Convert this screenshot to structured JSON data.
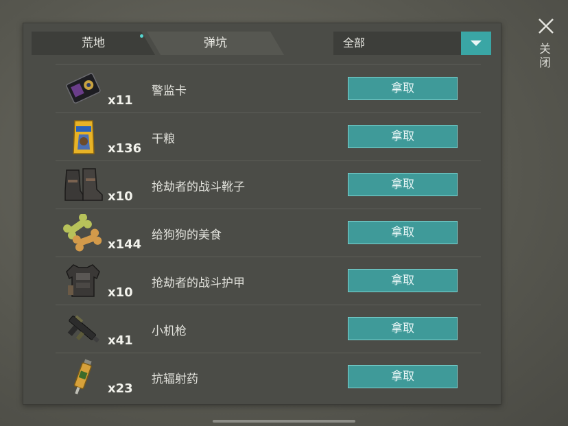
{
  "tabs": [
    {
      "label": "荒地",
      "active": true,
      "has_notification": true
    },
    {
      "label": "弹坑",
      "active": false
    }
  ],
  "filter": {
    "selected": "全部"
  },
  "close": {
    "label": "关闭"
  },
  "take_label": "拿取",
  "items": [
    {
      "count": "x11",
      "name": "警监卡",
      "icon": "police-card-icon"
    },
    {
      "count": "x136",
      "name": "干粮",
      "icon": "dry-food-bag-icon"
    },
    {
      "count": "x10",
      "name": "抢劫者的战斗靴子",
      "icon": "combat-boots-icon"
    },
    {
      "count": "x144",
      "name": "给狗狗的美食",
      "icon": "dog-treat-bone-icon"
    },
    {
      "count": "x10",
      "name": "抢劫者的战斗护甲",
      "icon": "combat-armor-icon"
    },
    {
      "count": "x41",
      "name": "小机枪",
      "icon": "small-machine-gun-icon"
    },
    {
      "count": "x23",
      "name": "抗辐射药",
      "icon": "anti-radiation-syringe-icon"
    }
  ],
  "colors": {
    "accent": "#3aa6a5",
    "panel": "#4b4c47",
    "notification_dot": "#56d6d0"
  }
}
